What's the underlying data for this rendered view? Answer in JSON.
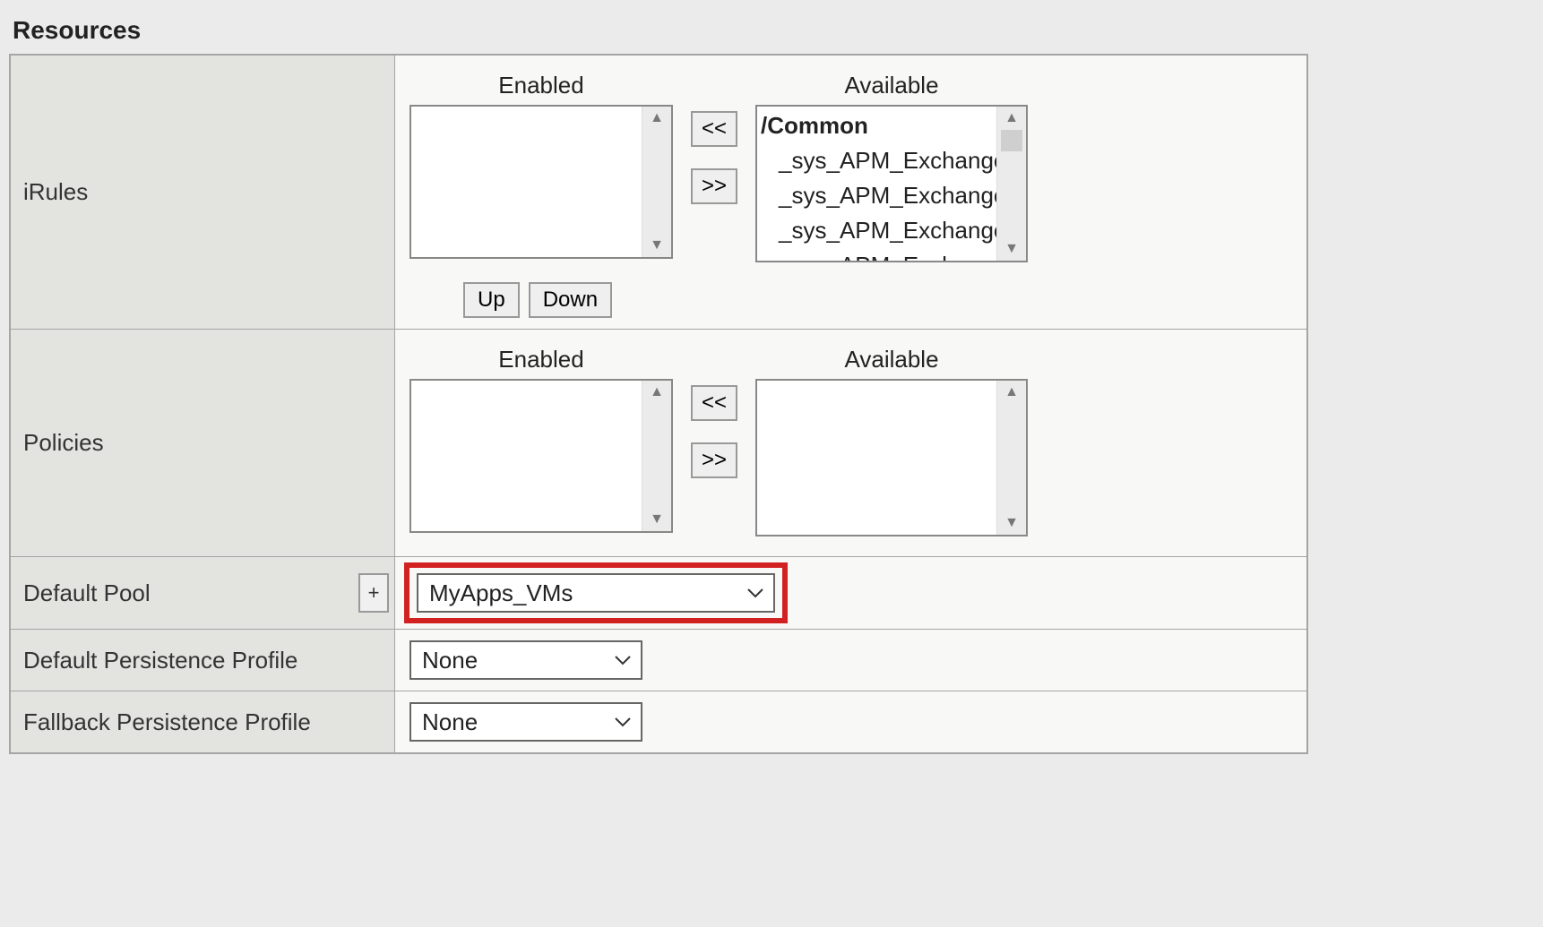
{
  "section_title": "Resources",
  "rows": {
    "irules": {
      "label": "iRules",
      "enabled_header": "Enabled",
      "available_header": "Available",
      "available_group": "/Common",
      "available_items": [
        "_sys_APM_ExchangeSupport_OA",
        "_sys_APM_ExchangeSupport_OA",
        "_sys_APM_ExchangeSupport_he",
        "_sys_APM_ExchangeSupport_ma"
      ],
      "move_left": "<<",
      "move_right": ">>",
      "up": "Up",
      "down": "Down"
    },
    "policies": {
      "label": "Policies",
      "enabled_header": "Enabled",
      "available_header": "Available",
      "move_left": "<<",
      "move_right": ">>"
    },
    "default_pool": {
      "label": "Default Pool",
      "plus": "+",
      "value": "MyApps_VMs"
    },
    "default_persistence": {
      "label": "Default Persistence Profile",
      "value": "None"
    },
    "fallback_persistence": {
      "label": "Fallback Persistence Profile",
      "value": "None"
    }
  }
}
